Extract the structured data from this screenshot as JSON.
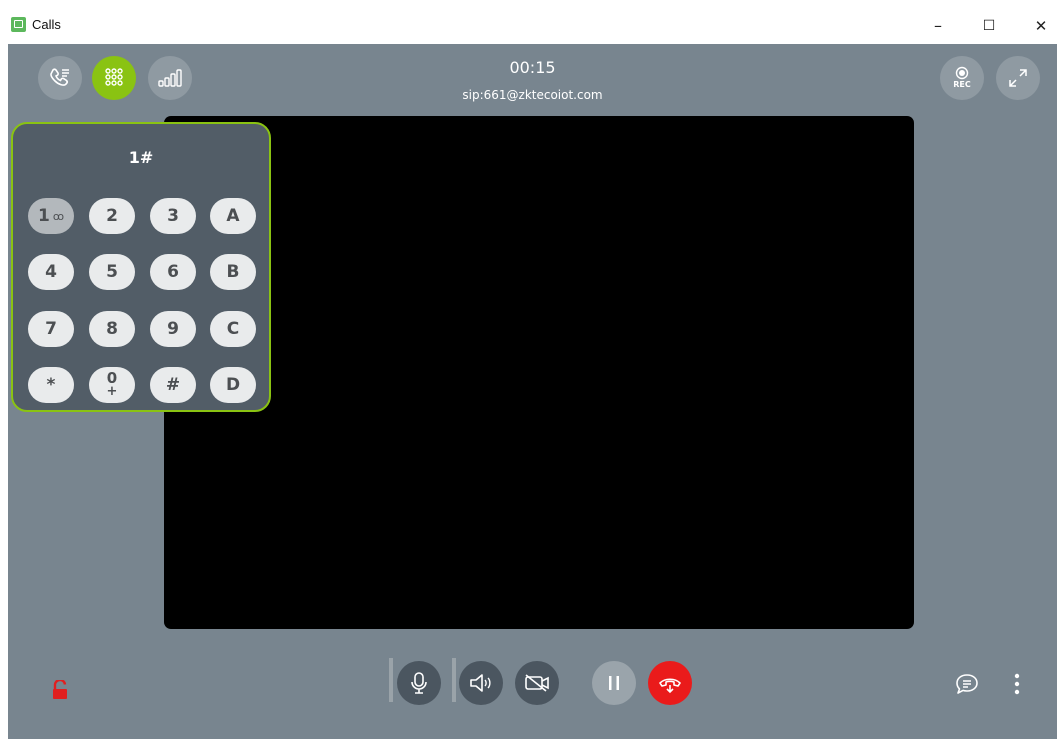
{
  "window": {
    "title": "Calls",
    "minimize": "–",
    "maximize": "☐",
    "close": "✕"
  },
  "call": {
    "duration": "00:15",
    "sip": "sip:661@zktecoiot.com"
  },
  "top_left_buttons": [
    {
      "name": "call-history-button",
      "icon": "phone-list-icon"
    },
    {
      "name": "dialpad-toggle-button",
      "icon": "dialpad-icon",
      "active": true
    },
    {
      "name": "signal-stats-button",
      "icon": "signal-bars-icon"
    }
  ],
  "top_right_buttons": {
    "rec_label": "REC"
  },
  "dialpad": {
    "display": "1#",
    "keys": [
      {
        "main": "1",
        "sub": "ꝏ"
      },
      {
        "main": "2"
      },
      {
        "main": "3"
      },
      {
        "main": "A"
      },
      {
        "main": "4"
      },
      {
        "main": "5"
      },
      {
        "main": "6"
      },
      {
        "main": "B"
      },
      {
        "main": "7"
      },
      {
        "main": "8"
      },
      {
        "main": "9"
      },
      {
        "main": "C"
      },
      {
        "main": "*"
      },
      {
        "main": "0",
        "sub": "+"
      },
      {
        "main": "#"
      },
      {
        "main": "D"
      }
    ]
  },
  "colors": {
    "accent": "#8ac312",
    "hangup": "#ea1b1b",
    "lock": "#e02020",
    "stage": "#78858f"
  }
}
